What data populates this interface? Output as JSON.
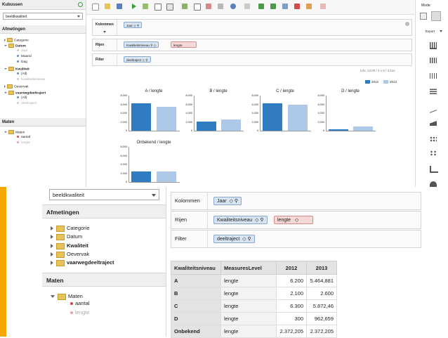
{
  "top": {
    "left_panel": {
      "cubes_title": "Kubussen",
      "cube_selected": "beeldkwaliteit",
      "dimensions_title": "Afmetingen",
      "dimensions": [
        {
          "label": "Categorie",
          "open": false
        },
        {
          "label": "Datum",
          "open": true,
          "children": [
            "Jaar",
            "Maand",
            "Dag"
          ]
        },
        {
          "label": "Kwaliteit",
          "open": true,
          "children": [
            "(All)",
            "Kwaliteitsniveau"
          ]
        },
        {
          "label": "Oevervak",
          "open": false
        },
        {
          "label": "vaarwegdeeltraject",
          "open": true,
          "children": [
            "(All)",
            "deeltraject"
          ]
        }
      ],
      "measures_title": "Maten",
      "measures_group": "Maten",
      "measures": [
        "aantal",
        "lengte"
      ]
    },
    "shelves": {
      "columns_label": "Kolommen",
      "columns_chip": "Jaar",
      "rows_label": "Rijen",
      "rows_chips": [
        "Kwaliteitsniveau",
        "lengte"
      ],
      "filter_label": "Filter",
      "filter_chip": "deeltraject"
    },
    "info": "Info: 13:00  /  4 x 8  /  3.51s",
    "legend": [
      "2012",
      "2013"
    ],
    "colors": {
      "dark": "#2f7cc0",
      "light": "#aec9e8"
    },
    "mode_label": "Mode:",
    "export_label": "Export"
  },
  "chart_data": {
    "type": "bar",
    "categories": [
      "2012",
      "2013"
    ],
    "panels": [
      {
        "title": "A / lengte",
        "values": [
          6200,
          5464.881
        ]
      },
      {
        "title": "B / lengte",
        "values": [
          2100,
          2600
        ]
      },
      {
        "title": "C / lengte",
        "values": [
          6300,
          5872.46
        ]
      },
      {
        "title": "D / lengte",
        "values": [
          300,
          962.659
        ]
      },
      {
        "title": "Onbekend / lengte",
        "values": [
          2372.205,
          2372.205
        ]
      }
    ],
    "yticks": [
      "8,000",
      "6,000",
      "4,000",
      "2,000",
      "0"
    ],
    "ylim": [
      0,
      8000
    ],
    "legend_position": "top-right"
  },
  "bottom": {
    "cube_selected": "beeldkwaliteit",
    "dimensions_title": "Afmetingen",
    "dimensions": [
      "Categorie",
      "Datum",
      "Kwaliteit",
      "Oevervak",
      "vaarwegdeeltraject"
    ],
    "measures_title": "Maten",
    "measures_group": "Maten",
    "measures": [
      "aantal",
      "lengte"
    ],
    "shelves": {
      "columns_label": "Kolommen",
      "columns_chip": "Jaar",
      "rows_label": "Rijen",
      "rows_chips": [
        "Kwaliteitsniveau",
        "lengte"
      ],
      "filter_label": "Filter",
      "filter_chip": "deeltraject"
    },
    "table": {
      "headers": [
        "Kwaliteitsniveau",
        "MeasuresLevel",
        "2012",
        "2013"
      ],
      "rows": [
        [
          "A",
          "lengte",
          "6.200",
          "5.464,881"
        ],
        [
          "B",
          "lengte",
          "2.100",
          "2.600"
        ],
        [
          "C",
          "lengte",
          "6.300",
          "5.872,46"
        ],
        [
          "D",
          "lengte",
          "300",
          "962,659"
        ],
        [
          "Onbekend",
          "lengte",
          "2.372,205",
          "2.372,205"
        ]
      ]
    }
  }
}
